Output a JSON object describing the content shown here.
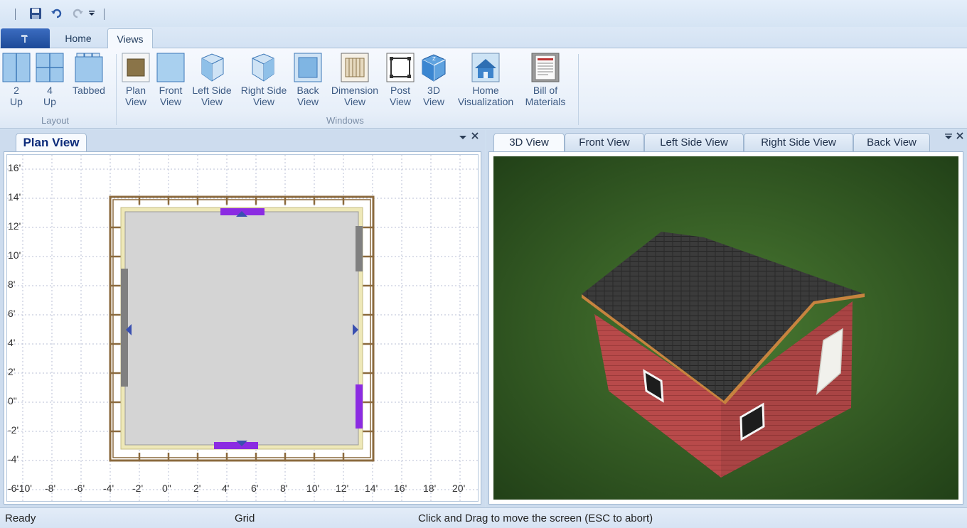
{
  "ribbon_tabs": {
    "home": "Home",
    "views": "Views"
  },
  "layout_group": {
    "label": "Layout",
    "two_up": {
      "l1": "2",
      "l2": "Up"
    },
    "four_up": {
      "l1": "4",
      "l2": "Up"
    },
    "tabbed": {
      "l1": "Tabbed"
    }
  },
  "windows_group": {
    "label": "Windows",
    "plan": {
      "l1": "Plan",
      "l2": "View"
    },
    "front": {
      "l1": "Front",
      "l2": "View"
    },
    "left_side": {
      "l1": "Left Side",
      "l2": "View"
    },
    "right_side": {
      "l1": "Right Side",
      "l2": "View"
    },
    "back": {
      "l1": "Back",
      "l2": "View"
    },
    "dimension": {
      "l1": "Dimension",
      "l2": "View"
    },
    "post": {
      "l1": "Post",
      "l2": "View"
    },
    "three_d": {
      "l1": "3D",
      "l2": "View"
    },
    "home_vis": {
      "l1": "Home",
      "l2": "Visualization"
    },
    "bom": {
      "l1": "Bill of",
      "l2": "Materials"
    }
  },
  "left_panel": {
    "tab": "Plan View"
  },
  "right_panel": {
    "tabs": [
      "3D View",
      "Front View",
      "Left Side View",
      "Right Side View",
      "Back View"
    ]
  },
  "plan": {
    "y_labels": [
      "16'",
      "14'",
      "12'",
      "10'",
      "8'",
      "6'",
      "4'",
      "2'",
      "0\"",
      "-2'",
      "-4'",
      "-6'"
    ],
    "x_labels": [
      "-10'",
      "-8'",
      "-6'",
      "-4'",
      "-2'",
      "0\"",
      "2'",
      "4'",
      "6'",
      "8'",
      "10'",
      "12'",
      "14'",
      "16'",
      "18'",
      "20'"
    ]
  },
  "status": {
    "ready": "Ready",
    "grid": "Grid",
    "hint": "Click and Drag to move the screen  (ESC to abort)"
  },
  "colors": {
    "accent": "#1d4a98",
    "wall_opening": "#8b2be2",
    "door_wall": "#808080",
    "roof": "#3a3a3a",
    "siding": "#b84a4a",
    "grass": "#3d6b2a"
  }
}
